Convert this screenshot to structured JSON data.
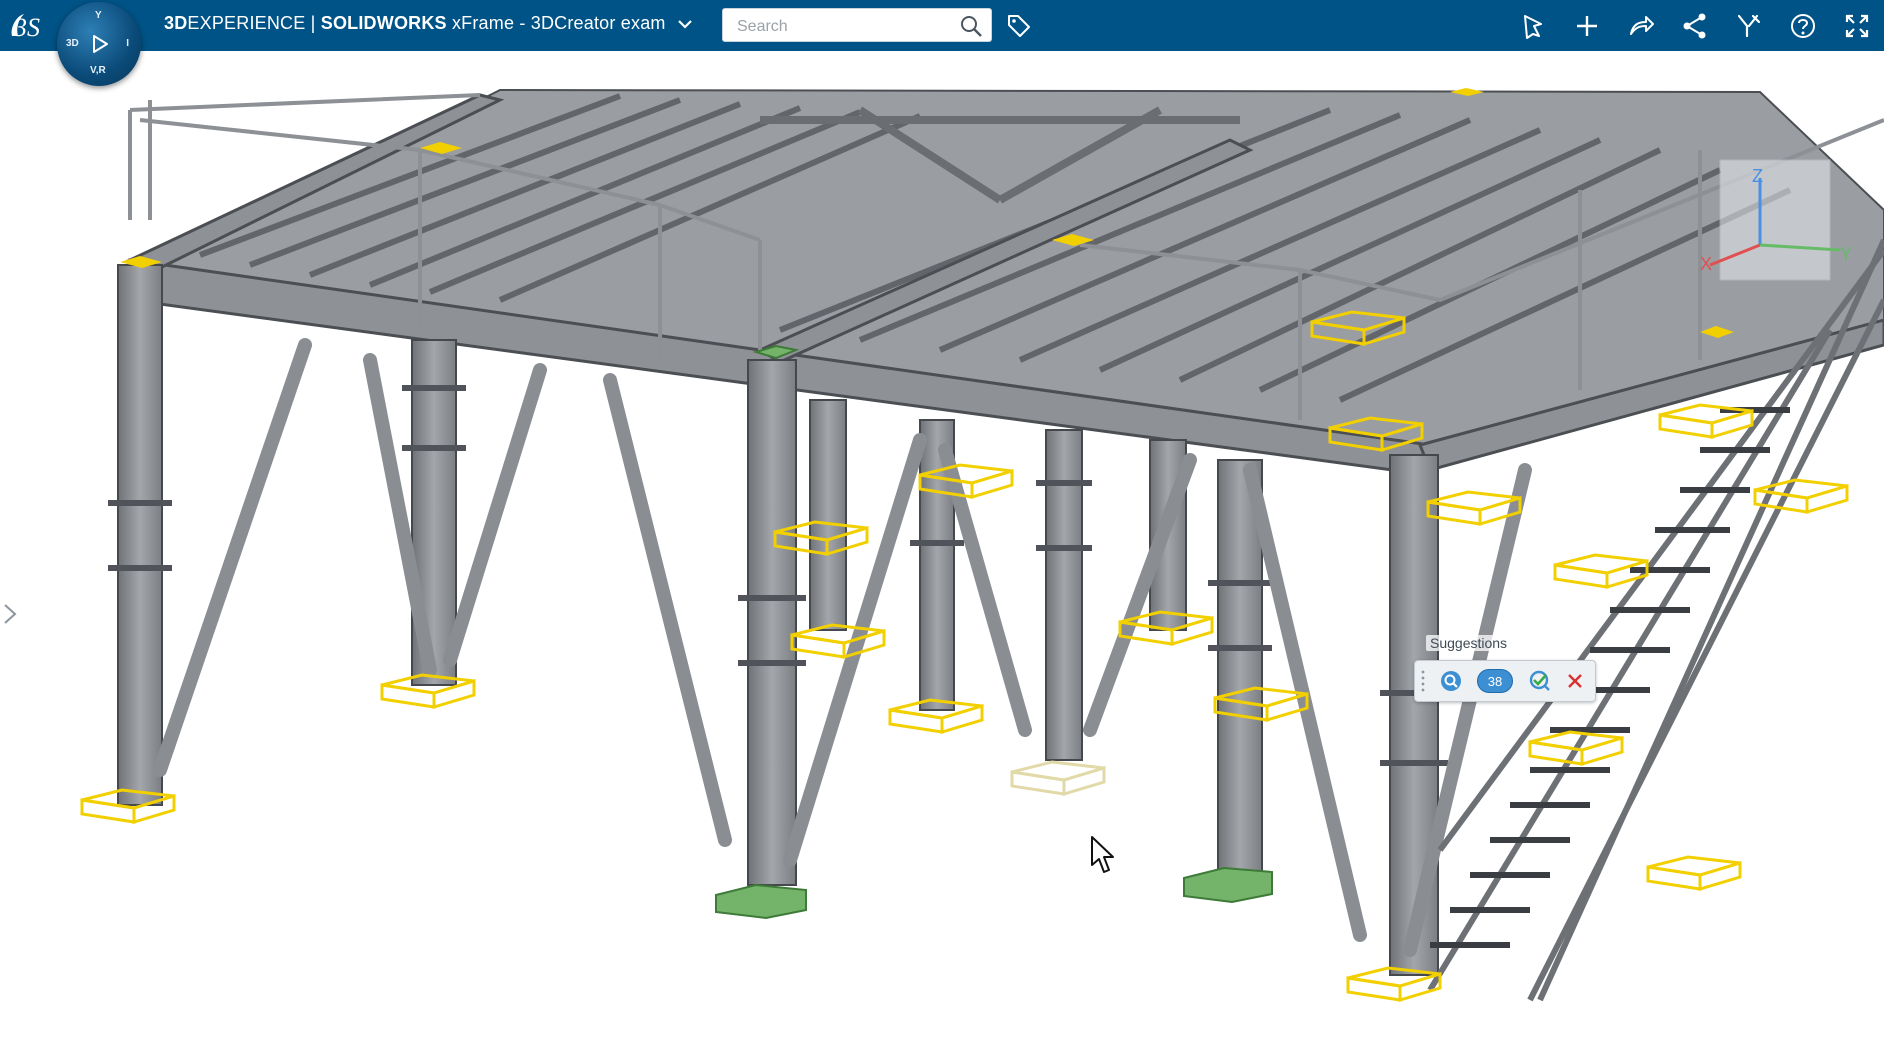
{
  "header": {
    "brand_bold": "3D",
    "brand_rest": "EXPERIENCE",
    "separator": " | ",
    "app_name": "SOLIDWORKS",
    "doc_title": " xFrame - 3DCreator exam"
  },
  "compass": {
    "label_3d": "3D",
    "label_vr": "V,R",
    "label_top": "Y",
    "label_right": "I"
  },
  "search": {
    "placeholder": "Search"
  },
  "icons": {
    "logo": "dassault-logo",
    "search": "search-icon",
    "tag": "tag-icon",
    "toolbar": [
      "feedback-icon",
      "add-icon",
      "share-arrow-icon",
      "network-share-icon",
      "tools-icon",
      "help-icon",
      "fullscreen-icon"
    ]
  },
  "suggestions": {
    "title": "Suggestions",
    "count": "38",
    "actions": [
      "find-suggestions-icon",
      "apply-suggestions-icon",
      "dismiss-icon"
    ]
  },
  "triad": {
    "x": "X",
    "y": "Y",
    "z": "Z"
  },
  "colors": {
    "topbar": "#005386",
    "steel": "#8b8e93",
    "highlight": "#f2d000",
    "selected_plate": "#74b36a",
    "suggestion_badge": "#3d8fd3"
  }
}
